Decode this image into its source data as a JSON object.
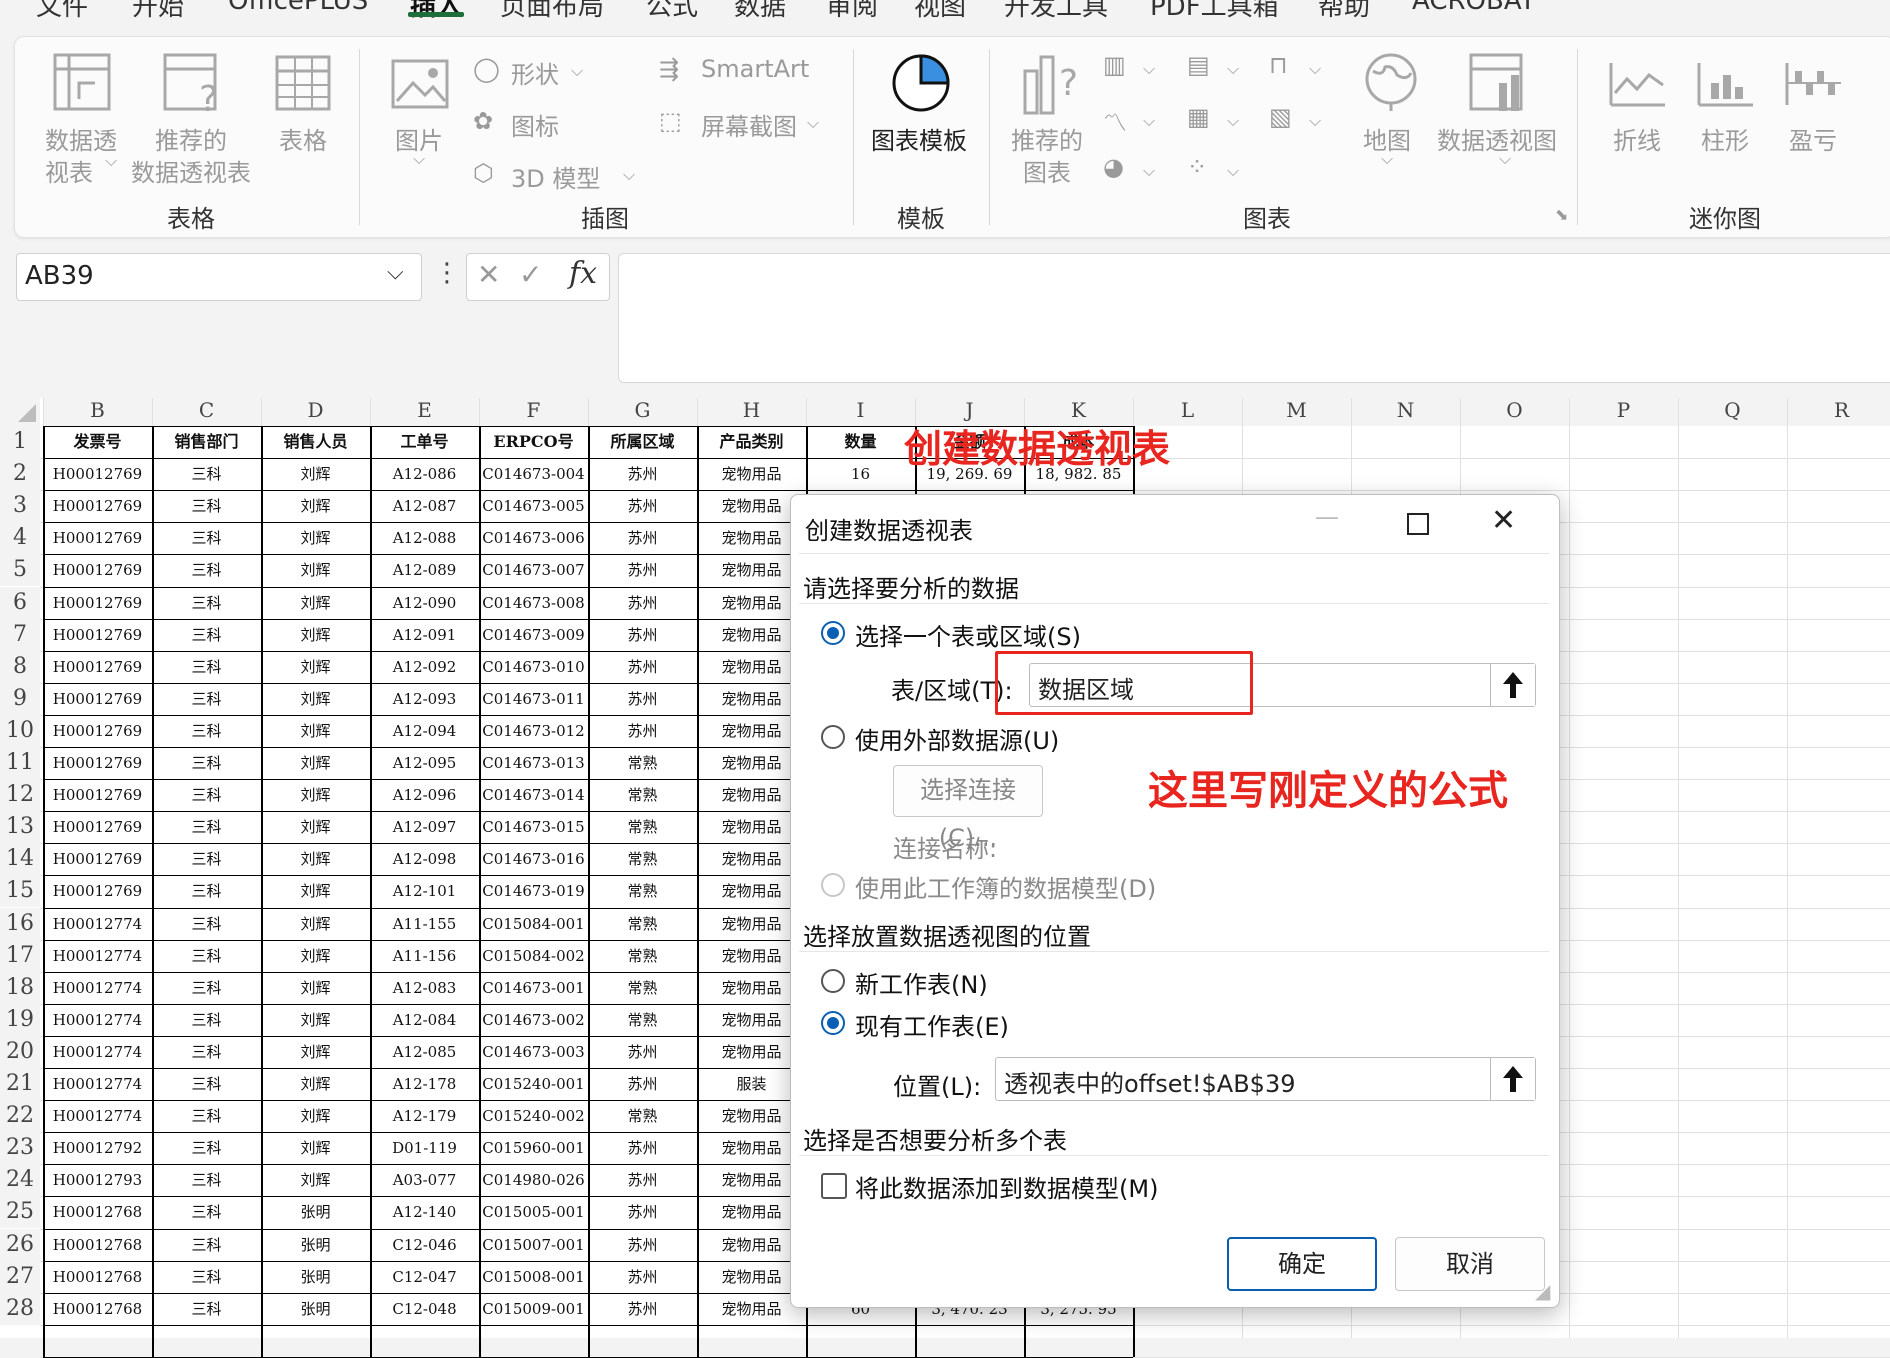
{
  "menu_tabs": [
    "文件",
    "开始",
    "OfficePLUS",
    "插入",
    "页面布局",
    "公式",
    "数据",
    "审阅",
    "视图",
    "开发工具",
    "PDF工具箱",
    "帮助",
    "ACROBAT"
  ],
  "active_tab": "插入",
  "ribbon": {
    "table_group": {
      "label": "表格",
      "pivot_line1": "数据透",
      "pivot_line2": "视表",
      "recommended_line1": "推荐的",
      "recommended_line2": "数据透视表",
      "table": "表格"
    },
    "illustration_group": {
      "label": "插图",
      "picture": "图片",
      "shapes": "形状",
      "icons": "图标",
      "model3d": "3D 模型",
      "smartart": "SmartArt",
      "screenshot": "屏幕截图"
    },
    "template_group": {
      "label": "模板",
      "chart_template": "图表模板"
    },
    "chart_group": {
      "label": "图表",
      "recommended_line1": "推荐的",
      "recommended_line2": "图表",
      "map": "地图",
      "pivot_chart": "数据透视图"
    },
    "sparkline_group": {
      "label": "迷你图",
      "line": "折线",
      "column": "柱形",
      "winloss": "盈亏"
    }
  },
  "formula_bar": {
    "name_box": "AB39",
    "fx": "fx",
    "formula": ""
  },
  "columns": [
    "B",
    "C",
    "D",
    "E",
    "F",
    "G",
    "H",
    "I",
    "J",
    "K",
    "L",
    "M",
    "N",
    "O",
    "P",
    "Q",
    "R"
  ],
  "table_headers": [
    "发票号",
    "销售部门",
    "销售人员",
    "工单号",
    "ERPCO号",
    "所属区域",
    "产品类别",
    "数量",
    "金额",
    "成本"
  ],
  "rows": [
    [
      "H00012769",
      "三科",
      "刘辉",
      "A12-086",
      "C014673-004",
      "苏州",
      "宠物用品",
      "16",
      "19, 269. 69",
      "18, 982. 85"
    ],
    [
      "H00012769",
      "三科",
      "刘辉",
      "A12-087",
      "C014673-005",
      "苏州",
      "宠物用品",
      "",
      "",
      ""
    ],
    [
      "H00012769",
      "三科",
      "刘辉",
      "A12-088",
      "C014673-006",
      "苏州",
      "宠物用品",
      "",
      "",
      ""
    ],
    [
      "H00012769",
      "三科",
      "刘辉",
      "A12-089",
      "C014673-007",
      "苏州",
      "宠物用品",
      "",
      "",
      ""
    ],
    [
      "H00012769",
      "三科",
      "刘辉",
      "A12-090",
      "C014673-008",
      "苏州",
      "宠物用品",
      "",
      "",
      ""
    ],
    [
      "H00012769",
      "三科",
      "刘辉",
      "A12-091",
      "C014673-009",
      "苏州",
      "宠物用品",
      "",
      "",
      ""
    ],
    [
      "H00012769",
      "三科",
      "刘辉",
      "A12-092",
      "C014673-010",
      "苏州",
      "宠物用品",
      "",
      "",
      ""
    ],
    [
      "H00012769",
      "三科",
      "刘辉",
      "A12-093",
      "C014673-011",
      "苏州",
      "宠物用品",
      "",
      "",
      ""
    ],
    [
      "H00012769",
      "三科",
      "刘辉",
      "A12-094",
      "C014673-012",
      "苏州",
      "宠物用品",
      "",
      "",
      ""
    ],
    [
      "H00012769",
      "三科",
      "刘辉",
      "A12-095",
      "C014673-013",
      "常熟",
      "宠物用品",
      "",
      "",
      ""
    ],
    [
      "H00012769",
      "三科",
      "刘辉",
      "A12-096",
      "C014673-014",
      "常熟",
      "宠物用品",
      "",
      "",
      ""
    ],
    [
      "H00012769",
      "三科",
      "刘辉",
      "A12-097",
      "C014673-015",
      "常熟",
      "宠物用品",
      "",
      "",
      ""
    ],
    [
      "H00012769",
      "三科",
      "刘辉",
      "A12-098",
      "C014673-016",
      "常熟",
      "宠物用品",
      "",
      "",
      ""
    ],
    [
      "H00012769",
      "三科",
      "刘辉",
      "A12-101",
      "C014673-019",
      "常熟",
      "宠物用品",
      "",
      "",
      ""
    ],
    [
      "H00012774",
      "三科",
      "刘辉",
      "A11-155",
      "C015084-001",
      "常熟",
      "宠物用品",
      "",
      "",
      ""
    ],
    [
      "H00012774",
      "三科",
      "刘辉",
      "A11-156",
      "C015084-002",
      "常熟",
      "宠物用品",
      "",
      "",
      ""
    ],
    [
      "H00012774",
      "三科",
      "刘辉",
      "A12-083",
      "C014673-001",
      "常熟",
      "宠物用品",
      "",
      "",
      ""
    ],
    [
      "H00012774",
      "三科",
      "刘辉",
      "A12-084",
      "C014673-002",
      "常熟",
      "宠物用品",
      "",
      "",
      ""
    ],
    [
      "H00012774",
      "三科",
      "刘辉",
      "A12-085",
      "C014673-003",
      "苏州",
      "宠物用品",
      "",
      "",
      ""
    ],
    [
      "H00012774",
      "三科",
      "刘辉",
      "A12-178",
      "C015240-001",
      "苏州",
      "服装",
      "",
      "",
      ""
    ],
    [
      "H00012774",
      "三科",
      "刘辉",
      "A12-179",
      "C015240-002",
      "常熟",
      "宠物用品",
      "",
      "",
      ""
    ],
    [
      "H00012792",
      "三科",
      "刘辉",
      "D01-119",
      "C015960-001",
      "苏州",
      "宠物用品",
      "",
      "",
      ""
    ],
    [
      "H00012793",
      "三科",
      "刘辉",
      "A03-077",
      "C014980-026",
      "苏州",
      "宠物用品",
      "",
      "",
      ""
    ],
    [
      "H00012768",
      "三科",
      "张明",
      "A12-140",
      "C015005-001",
      "苏州",
      "宠物用品",
      "",
      "",
      ""
    ],
    [
      "H00012768",
      "三科",
      "张明",
      "C12-046",
      "C015007-001",
      "苏州",
      "宠物用品",
      "",
      "",
      ""
    ],
    [
      "H00012768",
      "三科",
      "张明",
      "C12-047",
      "C015008-001",
      "苏州",
      "宠物用品",
      "",
      "",
      ""
    ],
    [
      "H00012768",
      "三科",
      "张明",
      "C12-048",
      "C015009-001",
      "苏州",
      "宠物用品",
      "60",
      "3, 470. 23",
      "3, 275. 95"
    ]
  ],
  "annotations": {
    "title": "创建数据透视表",
    "hint": "这里写刚定义的公式"
  },
  "dialog": {
    "title": "创建数据透视表",
    "section1": "请选择要分析的数据",
    "opt_table": "选择一个表或区域(S)",
    "range_label": "表/区域(T):",
    "range_value": "数据区域",
    "opt_external": "使用外部数据源(U)",
    "choose_connection": "选择连接(C)...",
    "connection_name": "连接名称:",
    "opt_datamodel": "使用此工作簿的数据模型(D)",
    "section2": "选择放置数据透视图的位置",
    "opt_new": "新工作表(N)",
    "opt_existing": "现有工作表(E)",
    "location_label": "位置(L):",
    "location_value": "透视表中的offset!$AB$39",
    "section3": "选择是否想要分析多个表",
    "add_model": "将此数据添加到数据模型(M)",
    "ok": "确定",
    "cancel": "取消"
  },
  "colors": {
    "accent": "#0a5fb4",
    "annotation": "#e8261f",
    "excel_green": "#1e6e3c"
  }
}
